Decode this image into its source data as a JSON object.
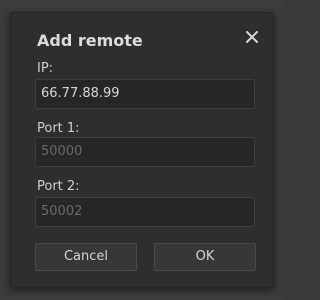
{
  "dialog": {
    "title": "Add remote",
    "close_icon": "close-icon"
  },
  "fields": {
    "ip": {
      "label": "IP:",
      "value": "66.77.88.99"
    },
    "port1": {
      "label": "Port 1:",
      "value": "50000"
    },
    "port2": {
      "label": "Port 2:",
      "value": "50002"
    }
  },
  "buttons": {
    "cancel": "Cancel",
    "ok": "OK"
  }
}
